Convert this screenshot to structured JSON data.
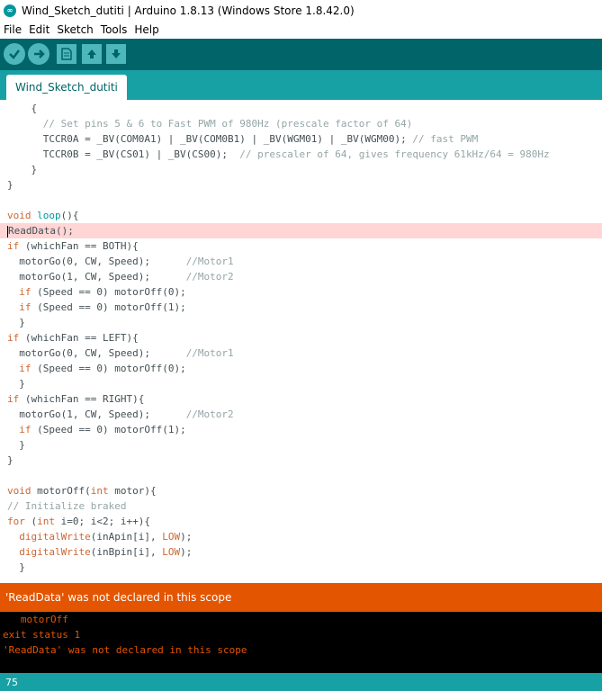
{
  "window": {
    "title": "Wind_Sketch_dutiti | Arduino 1.8.13 (Windows Store 1.8.42.0)"
  },
  "menu": {
    "items": [
      "File",
      "Edit",
      "Sketch",
      "Tools",
      "Help"
    ]
  },
  "toolbar": {
    "buttons": [
      "verify-icon",
      "upload-icon",
      "new-icon",
      "open-icon",
      "save-icon"
    ]
  },
  "tab": {
    "label": "Wind_Sketch_dutiti"
  },
  "colors": {
    "keyword": "#00979c",
    "type": "#cc6633",
    "comment": "#95a5a6",
    "text": "#434f54",
    "error_bar": "#e35500",
    "teal_dark": "#006468",
    "teal_light": "#17a1a5"
  },
  "code": {
    "lines": [
      [
        [
          "    {",
          "text"
        ]
      ],
      [
        [
          "      // Set pins 5 & 6 to Fast PWM of 980Hz (prescale factor of 64)",
          "comment"
        ]
      ],
      [
        [
          "      TCCR0A = _BV(COM0A1) | _BV(COM0B1) | _BV(WGM01) | _BV(WGM00); ",
          "text"
        ],
        [
          "// fast PWM",
          "comment"
        ]
      ],
      [
        [
          "      TCCR0B = _BV(CS01) | _BV(CS00);  ",
          "text"
        ],
        [
          "// prescaler of 64, gives frequency 61kHz/64 = 980Hz",
          "comment"
        ]
      ],
      [
        [
          "    }",
          "text"
        ]
      ],
      [
        [
          "}",
          "text"
        ]
      ],
      [
        [
          "",
          "text"
        ]
      ],
      [
        [
          "void",
          "type"
        ],
        [
          " ",
          "text"
        ],
        [
          "loop",
          "keyword"
        ],
        [
          "(){",
          "text"
        ]
      ],
      [
        [
          "ReadData();",
          "text"
        ]
      ],
      [
        [
          "if",
          "type"
        ],
        [
          " (whichFan == BOTH){",
          "text"
        ]
      ],
      [
        [
          "  motorGo(0, CW, Speed);      ",
          "text"
        ],
        [
          "//Motor1",
          "comment"
        ]
      ],
      [
        [
          "  motorGo(1, CW, Speed);      ",
          "text"
        ],
        [
          "//Motor2",
          "comment"
        ]
      ],
      [
        [
          "  ",
          "text"
        ],
        [
          "if",
          "type"
        ],
        [
          " (Speed == 0) motorOff(0);",
          "text"
        ]
      ],
      [
        [
          "  ",
          "text"
        ],
        [
          "if",
          "type"
        ],
        [
          " (Speed == 0) motorOff(1);",
          "text"
        ]
      ],
      [
        [
          "  }",
          "text"
        ]
      ],
      [
        [
          "if",
          "type"
        ],
        [
          " (whichFan == LEFT){",
          "text"
        ]
      ],
      [
        [
          "  motorGo(0, CW, Speed);      ",
          "text"
        ],
        [
          "//Motor1",
          "comment"
        ]
      ],
      [
        [
          "  ",
          "text"
        ],
        [
          "if",
          "type"
        ],
        [
          " (Speed == 0) motorOff(0);",
          "text"
        ]
      ],
      [
        [
          "  }",
          "text"
        ]
      ],
      [
        [
          "if",
          "type"
        ],
        [
          " (whichFan == RIGHT){",
          "text"
        ]
      ],
      [
        [
          "  motorGo(1, CW, Speed);      ",
          "text"
        ],
        [
          "//Motor2",
          "comment"
        ]
      ],
      [
        [
          "  ",
          "text"
        ],
        [
          "if",
          "type"
        ],
        [
          " (Speed == 0) motorOff(1);",
          "text"
        ]
      ],
      [
        [
          "  }",
          "text"
        ]
      ],
      [
        [
          "}",
          "text"
        ]
      ],
      [
        [
          "",
          "text"
        ]
      ],
      [
        [
          "void",
          "type"
        ],
        [
          " motorOff(",
          "text"
        ],
        [
          "int",
          "type"
        ],
        [
          " motor){",
          "text"
        ]
      ],
      [
        [
          "// Initialize braked",
          "comment"
        ]
      ],
      [
        [
          "for",
          "type"
        ],
        [
          " (",
          "text"
        ],
        [
          "int",
          "type"
        ],
        [
          " i=0; i<2; i++){",
          "text"
        ]
      ],
      [
        [
          "  ",
          "text"
        ],
        [
          "digitalWrite",
          "type"
        ],
        [
          "(inApin[i], ",
          "text"
        ],
        [
          "LOW",
          "type"
        ],
        [
          ");",
          "text"
        ]
      ],
      [
        [
          "  ",
          "text"
        ],
        [
          "digitalWrite",
          "type"
        ],
        [
          "(inBpin[i], ",
          "text"
        ],
        [
          "LOW",
          "type"
        ],
        [
          ");",
          "text"
        ]
      ],
      [
        [
          "  }",
          "text"
        ]
      ]
    ],
    "highlight_line": 8
  },
  "status": {
    "message": "'ReadData' was not declared in this scope"
  },
  "console": {
    "lines": [
      [
        "   motorOff",
        "#e35500"
      ],
      [
        "exit status 1",
        "#e35500"
      ],
      [
        "'ReadData' was not declared in this scope",
        "#e35500"
      ]
    ]
  },
  "footer": {
    "line_number": "75"
  }
}
